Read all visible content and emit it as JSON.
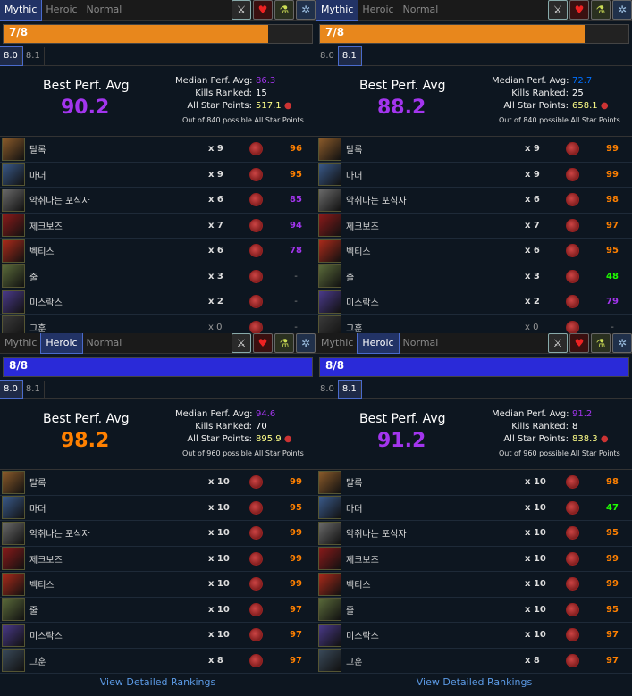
{
  "tabs": [
    "Mythic",
    "Heroic",
    "Normal"
  ],
  "patches": [
    "8.0",
    "8.1"
  ],
  "footer_link": "View Detailed Rankings",
  "labels": {
    "best_perf_avg": "Best Perf. Avg",
    "median_perf_avg": "Median Perf. Avg:",
    "kills_ranked": "Kills Ranked:",
    "all_star_points": "All Star Points:"
  },
  "panels": [
    {
      "active_tab": "Mythic",
      "active_patch": "8.0",
      "progress_text": "7/8",
      "progress_value": 0.875,
      "progress_color": "#e8871c",
      "best_perf": "90.2",
      "best_perf_color": "#a335ee",
      "median": "86.3",
      "median_color": "#a335ee",
      "kills": "15",
      "points": "517.1",
      "out_of": "Out of 840 possible All Star Points",
      "bosses": [
        {
          "name": "탈록",
          "kills": "x 9",
          "pct": "96",
          "color": "#ff8000",
          "portrait": "#8a5a2a"
        },
        {
          "name": "마더",
          "kills": "x 9",
          "pct": "95",
          "color": "#ff8000",
          "portrait": "#3a5a8a"
        },
        {
          "name": "악취나는 포식자",
          "kills": "x 6",
          "pct": "85",
          "color": "#a335ee",
          "portrait": "#6a6a6a"
        },
        {
          "name": "제크보즈",
          "kills": "x 7",
          "pct": "94",
          "color": "#a335ee",
          "portrait": "#8a1a1a"
        },
        {
          "name": "벡티스",
          "kills": "x 6",
          "pct": "78",
          "color": "#a335ee",
          "portrait": "#aa2a1a"
        },
        {
          "name": "줄",
          "kills": "x 3",
          "pct": "-",
          "color": "#888888",
          "portrait": "#5a6a3a"
        },
        {
          "name": "미스락스",
          "kills": "x 2",
          "pct": "-",
          "color": "#888888",
          "portrait": "#4a3a8a"
        },
        {
          "name": "그훈",
          "kills": "x 0",
          "pct": "-",
          "color": "#888888",
          "portrait": "#3a3a3a"
        }
      ]
    },
    {
      "active_tab": "Mythic",
      "active_patch": "8.1",
      "progress_text": "7/8",
      "progress_value": 0.875,
      "progress_color": "#e8871c",
      "best_perf": "88.2",
      "best_perf_color": "#a335ee",
      "median": "72.7",
      "median_color": "#0070ff",
      "kills": "25",
      "points": "658.1",
      "out_of": "Out of 840 possible All Star Points",
      "bosses": [
        {
          "name": "탈록",
          "kills": "x 9",
          "pct": "99",
          "color": "#ff8000",
          "portrait": "#8a5a2a"
        },
        {
          "name": "마더",
          "kills": "x 9",
          "pct": "99",
          "color": "#ff8000",
          "portrait": "#3a5a8a"
        },
        {
          "name": "악취나는 포식자",
          "kills": "x 6",
          "pct": "98",
          "color": "#ff8000",
          "portrait": "#6a6a6a"
        },
        {
          "name": "제크보즈",
          "kills": "x 7",
          "pct": "97",
          "color": "#ff8000",
          "portrait": "#8a1a1a"
        },
        {
          "name": "벡티스",
          "kills": "x 6",
          "pct": "95",
          "color": "#ff8000",
          "portrait": "#aa2a1a"
        },
        {
          "name": "줄",
          "kills": "x 3",
          "pct": "48",
          "color": "#1eff00",
          "portrait": "#5a6a3a"
        },
        {
          "name": "미스락스",
          "kills": "x 2",
          "pct": "79",
          "color": "#a335ee",
          "portrait": "#4a3a8a"
        },
        {
          "name": "그훈",
          "kills": "x 0",
          "pct": "-",
          "color": "#888888",
          "portrait": "#3a3a3a"
        }
      ]
    },
    {
      "active_tab": "Heroic",
      "active_patch": "8.0",
      "progress_text": "8/8",
      "progress_value": 1.0,
      "progress_color": "#2a2ad8",
      "best_perf": "98.2",
      "best_perf_color": "#ff8000",
      "median": "94.6",
      "median_color": "#a335ee",
      "kills": "70",
      "points": "895.9",
      "out_of": "Out of 960 possible All Star Points",
      "bosses": [
        {
          "name": "탈록",
          "kills": "x 10",
          "pct": "99",
          "color": "#ff8000",
          "portrait": "#8a5a2a"
        },
        {
          "name": "마더",
          "kills": "x 10",
          "pct": "95",
          "color": "#ff8000",
          "portrait": "#3a5a8a"
        },
        {
          "name": "악취나는 포식자",
          "kills": "x 10",
          "pct": "99",
          "color": "#ff8000",
          "portrait": "#6a6a6a"
        },
        {
          "name": "제크보즈",
          "kills": "x 10",
          "pct": "99",
          "color": "#ff8000",
          "portrait": "#8a1a1a"
        },
        {
          "name": "벡티스",
          "kills": "x 10",
          "pct": "99",
          "color": "#ff8000",
          "portrait": "#aa2a1a"
        },
        {
          "name": "줄",
          "kills": "x 10",
          "pct": "97",
          "color": "#ff8000",
          "portrait": "#5a6a3a"
        },
        {
          "name": "미스락스",
          "kills": "x 10",
          "pct": "97",
          "color": "#ff8000",
          "portrait": "#4a3a8a"
        },
        {
          "name": "그훈",
          "kills": "x 8",
          "pct": "97",
          "color": "#ff8000",
          "portrait": "#3a4a5a"
        }
      ]
    },
    {
      "active_tab": "Heroic",
      "active_patch": "8.1",
      "progress_text": "8/8",
      "progress_value": 1.0,
      "progress_color": "#2a2ad8",
      "best_perf": "91.2",
      "best_perf_color": "#a335ee",
      "median": "91.2",
      "median_color": "#a335ee",
      "kills": "8",
      "points": "838.3",
      "out_of": "Out of 960 possible All Star Points",
      "bosses": [
        {
          "name": "탈록",
          "kills": "x 10",
          "pct": "98",
          "color": "#ff8000",
          "portrait": "#8a5a2a"
        },
        {
          "name": "마더",
          "kills": "x 10",
          "pct": "47",
          "color": "#1eff00",
          "portrait": "#3a5a8a"
        },
        {
          "name": "악취나는 포식자",
          "kills": "x 10",
          "pct": "95",
          "color": "#ff8000",
          "portrait": "#6a6a6a"
        },
        {
          "name": "제크보즈",
          "kills": "x 10",
          "pct": "99",
          "color": "#ff8000",
          "portrait": "#8a1a1a"
        },
        {
          "name": "벡티스",
          "kills": "x 10",
          "pct": "99",
          "color": "#ff8000",
          "portrait": "#aa2a1a"
        },
        {
          "name": "줄",
          "kills": "x 10",
          "pct": "95",
          "color": "#ff8000",
          "portrait": "#5a6a3a"
        },
        {
          "name": "미스락스",
          "kills": "x 10",
          "pct": "97",
          "color": "#ff8000",
          "portrait": "#4a3a8a"
        },
        {
          "name": "그훈",
          "kills": "x 8",
          "pct": "97",
          "color": "#ff8000",
          "portrait": "#3a4a5a"
        }
      ]
    }
  ]
}
